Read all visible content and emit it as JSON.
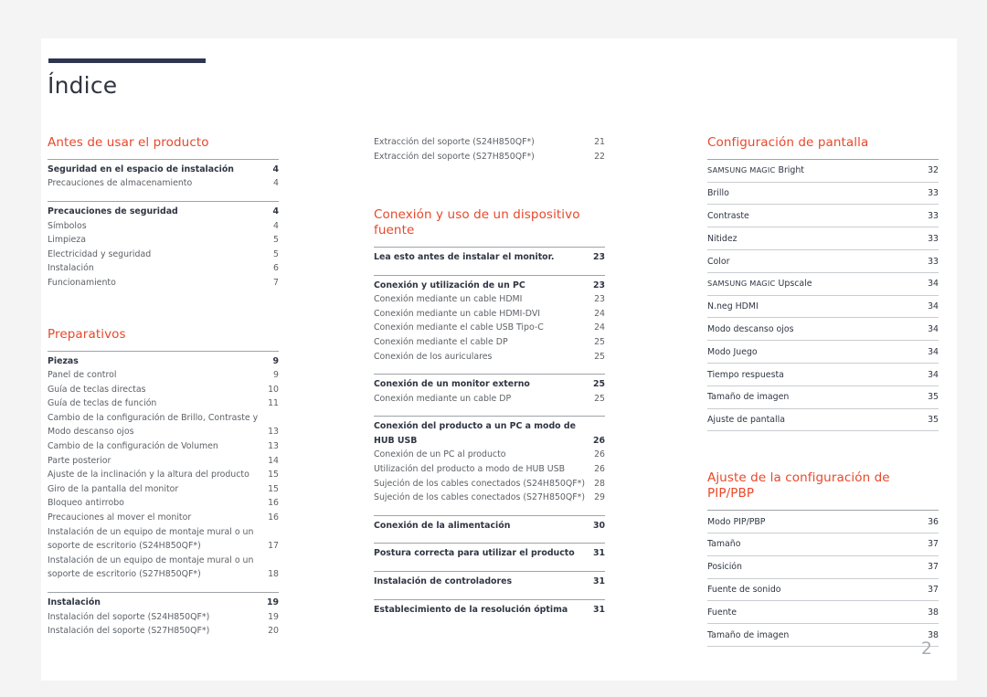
{
  "document": {
    "title": "Índice",
    "page_number": "2"
  },
  "colors": {
    "heading": "#e8482a",
    "title_rule": "#2d3551",
    "primary_text": "#2f3542",
    "secondary_text": "#5d6166",
    "page_number": "#a9acb0",
    "page_background": "#ffffff",
    "canvas_background": "#f4f4f4"
  },
  "columns": {
    "left": [
      {
        "heading": "Antes de usar el producto",
        "groups": [
          {
            "rule": true,
            "entries": [
              {
                "text": "Seguridad en el espacio de instalación",
                "page": "4",
                "level": "primary"
              },
              {
                "text": "Precauciones de almacenamiento",
                "page": "4",
                "level": "sub"
              }
            ]
          },
          {
            "rule": true,
            "entries": [
              {
                "text": "Precauciones de seguridad",
                "page": "4",
                "level": "primary"
              },
              {
                "text": "Símbolos",
                "page": "4",
                "level": "sub"
              },
              {
                "text": "Limpieza",
                "page": "5",
                "level": "sub"
              },
              {
                "text": "Electricidad y seguridad",
                "page": "5",
                "level": "sub"
              },
              {
                "text": "Instalación",
                "page": "6",
                "level": "sub"
              },
              {
                "text": "Funcionamiento",
                "page": "7",
                "level": "sub"
              }
            ]
          }
        ]
      },
      {
        "heading": "Preparativos",
        "groups": [
          {
            "rule": true,
            "entries": [
              {
                "text": "Piezas",
                "page": "9",
                "level": "primary"
              },
              {
                "text": "Panel de control",
                "page": "9",
                "level": "sub"
              },
              {
                "text": "Guía de teclas directas",
                "page": "10",
                "level": "sub"
              },
              {
                "text": "Guía de teclas de función",
                "page": "11",
                "level": "sub"
              },
              {
                "text": "Cambio de la configuración de Brillo, Contraste y Modo descanso ojos",
                "page": "13",
                "level": "sub"
              },
              {
                "text": "Cambio de la configuración de Volumen",
                "page": "13",
                "level": "sub"
              },
              {
                "text": "Parte posterior",
                "page": "14",
                "level": "sub"
              },
              {
                "text": "Ajuste de la inclinación y la altura del producto",
                "page": "15",
                "level": "sub"
              },
              {
                "text": "Giro de la pantalla del monitor",
                "page": "15",
                "level": "sub"
              },
              {
                "text": "Bloqueo antirrobo",
                "page": "16",
                "level": "sub"
              },
              {
                "text": "Precauciones al mover el monitor",
                "page": "16",
                "level": "sub"
              },
              {
                "text": "Instalación de un equipo de montaje mural o un soporte de escritorio (S24H850QF*)",
                "page": "17",
                "level": "sub"
              },
              {
                "text": "Instalación de un equipo de montaje mural o un soporte de escritorio (S27H850QF*)",
                "page": "18",
                "level": "sub"
              }
            ]
          },
          {
            "rule": true,
            "entries": [
              {
                "text": "Instalación",
                "page": "19",
                "level": "primary"
              },
              {
                "text": "Instalación del soporte (S24H850QF*)",
                "page": "19",
                "level": "sub"
              },
              {
                "text": "Instalación del soporte (S27H850QF*)",
                "page": "20",
                "level": "sub"
              }
            ]
          }
        ]
      }
    ],
    "middle": [
      {
        "heading": "",
        "groups": [
          {
            "rule": false,
            "entries": [
              {
                "text": "Extracción del soporte (S24H850QF*)",
                "page": "21",
                "level": "sub"
              },
              {
                "text": "Extracción del soporte (S27H850QF*)",
                "page": "22",
                "level": "sub"
              }
            ]
          }
        ]
      },
      {
        "heading": "Conexión y uso de un dispositivo fuente",
        "groups": [
          {
            "rule": true,
            "entries": [
              {
                "text": "Lea esto antes de instalar el monitor.",
                "page": "23",
                "level": "primary"
              }
            ]
          },
          {
            "rule": true,
            "entries": [
              {
                "text": "Conexión y utilización de un PC",
                "page": "23",
                "level": "primary"
              },
              {
                "text": "Conexión mediante un cable HDMI",
                "page": "23",
                "level": "sub"
              },
              {
                "text": "Conexión mediante un cable HDMI-DVI",
                "page": "24",
                "level": "sub"
              },
              {
                "text": "Conexión mediante el cable USB Tipo-C",
                "page": "24",
                "level": "sub"
              },
              {
                "text": "Conexión mediante el cable DP",
                "page": "25",
                "level": "sub"
              },
              {
                "text": "Conexión de los auriculares",
                "page": "25",
                "level": "sub"
              }
            ]
          },
          {
            "rule": true,
            "entries": [
              {
                "text": "Conexión de un monitor externo",
                "page": "25",
                "level": "primary"
              },
              {
                "text": "Conexión mediante un cable DP",
                "page": "25",
                "level": "sub"
              }
            ]
          },
          {
            "rule": true,
            "entries": [
              {
                "text": "Conexión del producto a un PC a modo de HUB USB",
                "page": "26",
                "level": "primary"
              },
              {
                "text": "Conexión de un PC al producto",
                "page": "26",
                "level": "sub"
              },
              {
                "text": "Utilización del producto a modo de HUB USB",
                "page": "26",
                "level": "sub"
              },
              {
                "text": "Sujeción de los cables conectados (S24H850QF*)",
                "page": "28",
                "level": "sub",
                "tight": true
              },
              {
                "text": "Sujeción de los cables conectados (S27H850QF*)",
                "page": "29",
                "level": "sub",
                "tight": true
              }
            ]
          },
          {
            "rule": true,
            "entries": [
              {
                "text": "Conexión de la alimentación",
                "page": "30",
                "level": "primary"
              }
            ]
          },
          {
            "rule": true,
            "entries": [
              {
                "text": "Postura correcta para utilizar el producto",
                "page": "31",
                "level": "primary"
              }
            ]
          },
          {
            "rule": true,
            "entries": [
              {
                "text": "Instalación de controladores",
                "page": "31",
                "level": "primary"
              }
            ]
          },
          {
            "rule": true,
            "entries": [
              {
                "text": "Establecimiento de la resolución óptima",
                "page": "31",
                "level": "primary"
              }
            ]
          }
        ]
      }
    ],
    "right": [
      {
        "heading": "Configuración de pantalla",
        "rows": [
          {
            "text": "SAMSUNG MAGIC Bright",
            "page": "32",
            "smallcaps_prefix": "SAMSUNG MAGIC",
            "rest": "Bright"
          },
          {
            "text": "Brillo",
            "page": "33"
          },
          {
            "text": "Contraste",
            "page": "33"
          },
          {
            "text": "Nitidez",
            "page": "33"
          },
          {
            "text": "Color",
            "page": "33"
          },
          {
            "text": "SAMSUNG MAGIC Upscale",
            "page": "34",
            "smallcaps_prefix": "SAMSUNG MAGIC",
            "rest": "Upscale"
          },
          {
            "text": "N.neg HDMI",
            "page": "34"
          },
          {
            "text": "Modo descanso ojos",
            "page": "34"
          },
          {
            "text": "Modo Juego",
            "page": "34"
          },
          {
            "text": "Tiempo respuesta",
            "page": "34"
          },
          {
            "text": "Tamaño de imagen",
            "page": "35"
          },
          {
            "text": "Ajuste de pantalla",
            "page": "35"
          }
        ]
      },
      {
        "heading": "Ajuste de la configuración de PIP/PBP",
        "rows": [
          {
            "text": "Modo PIP/PBP",
            "page": "36"
          },
          {
            "text": "Tamaño",
            "page": "37"
          },
          {
            "text": "Posición",
            "page": "37"
          },
          {
            "text": "Fuente de sonido",
            "page": "37"
          },
          {
            "text": "Fuente",
            "page": "38"
          },
          {
            "text": "Tamaño de imagen",
            "page": "38"
          }
        ]
      }
    ]
  }
}
